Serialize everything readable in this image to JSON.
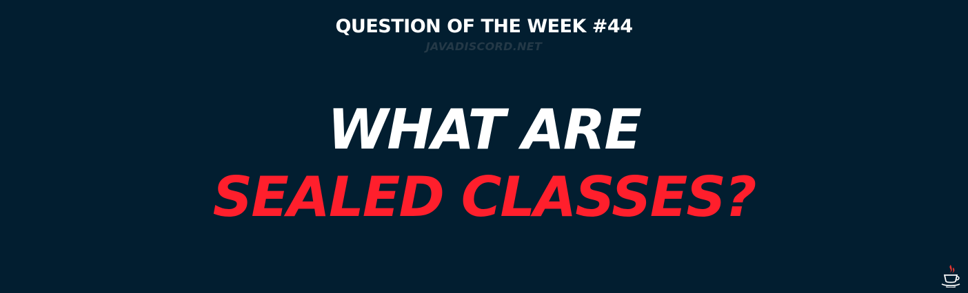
{
  "header": {
    "title": "QUESTION OF THE WEEK #44",
    "subtitle": "JAVADISCORD.NET"
  },
  "headline": {
    "line1": "WHAT ARE",
    "line2": "SEALED CLASSES?"
  },
  "logo": {
    "icon": "java-coffee-cup-icon"
  },
  "colors": {
    "background": "#021e30",
    "primary_text": "#ffffff",
    "accent": "#ff1f2c",
    "muted": "#243947"
  }
}
